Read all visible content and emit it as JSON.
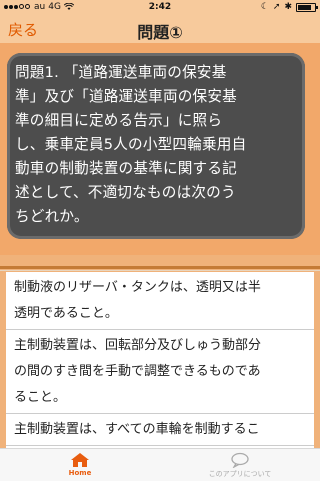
{
  "status_bar": {
    "carrier": "au",
    "network": "4G",
    "time": "2:42",
    "signal_bars_filled": 3,
    "signal_bars_total": 5,
    "battery_level": 0.85
  },
  "nav": {
    "back_label": "戻る",
    "title": "問題①"
  },
  "question": {
    "lines": [
      "問題1. 「道路運送車両の保安基",
      "準」及び「道路運送車両の保安基",
      "準の細目に定める告示」に照ら",
      "し、乗車定員5人の小型四輪乗用自",
      "動車の制動装置の基準に関する記",
      "述として、不適切なものは次のう",
      "ちどれか。"
    ]
  },
  "answers": [
    {
      "lines": [
        "制動液のリザーバ・タンクは、透明又は半",
        "透明であること。"
      ]
    },
    {
      "lines": [
        "主制動装置は、回転部分及びしゅう動部分",
        "の間のすき間を手動で調整できるものであ",
        "ること。"
      ]
    },
    {
      "lines": [
        "主制動装置は、すべての車輪を制動するこ"
      ]
    }
  ],
  "tab_bar": {
    "home_label": "Home",
    "about_label": "このアプリについて"
  },
  "colors": {
    "accent": "#e85d10",
    "header_bg": "#f7ca9c",
    "background": "#f0b27a",
    "card_bg": "#4d4d4d"
  }
}
